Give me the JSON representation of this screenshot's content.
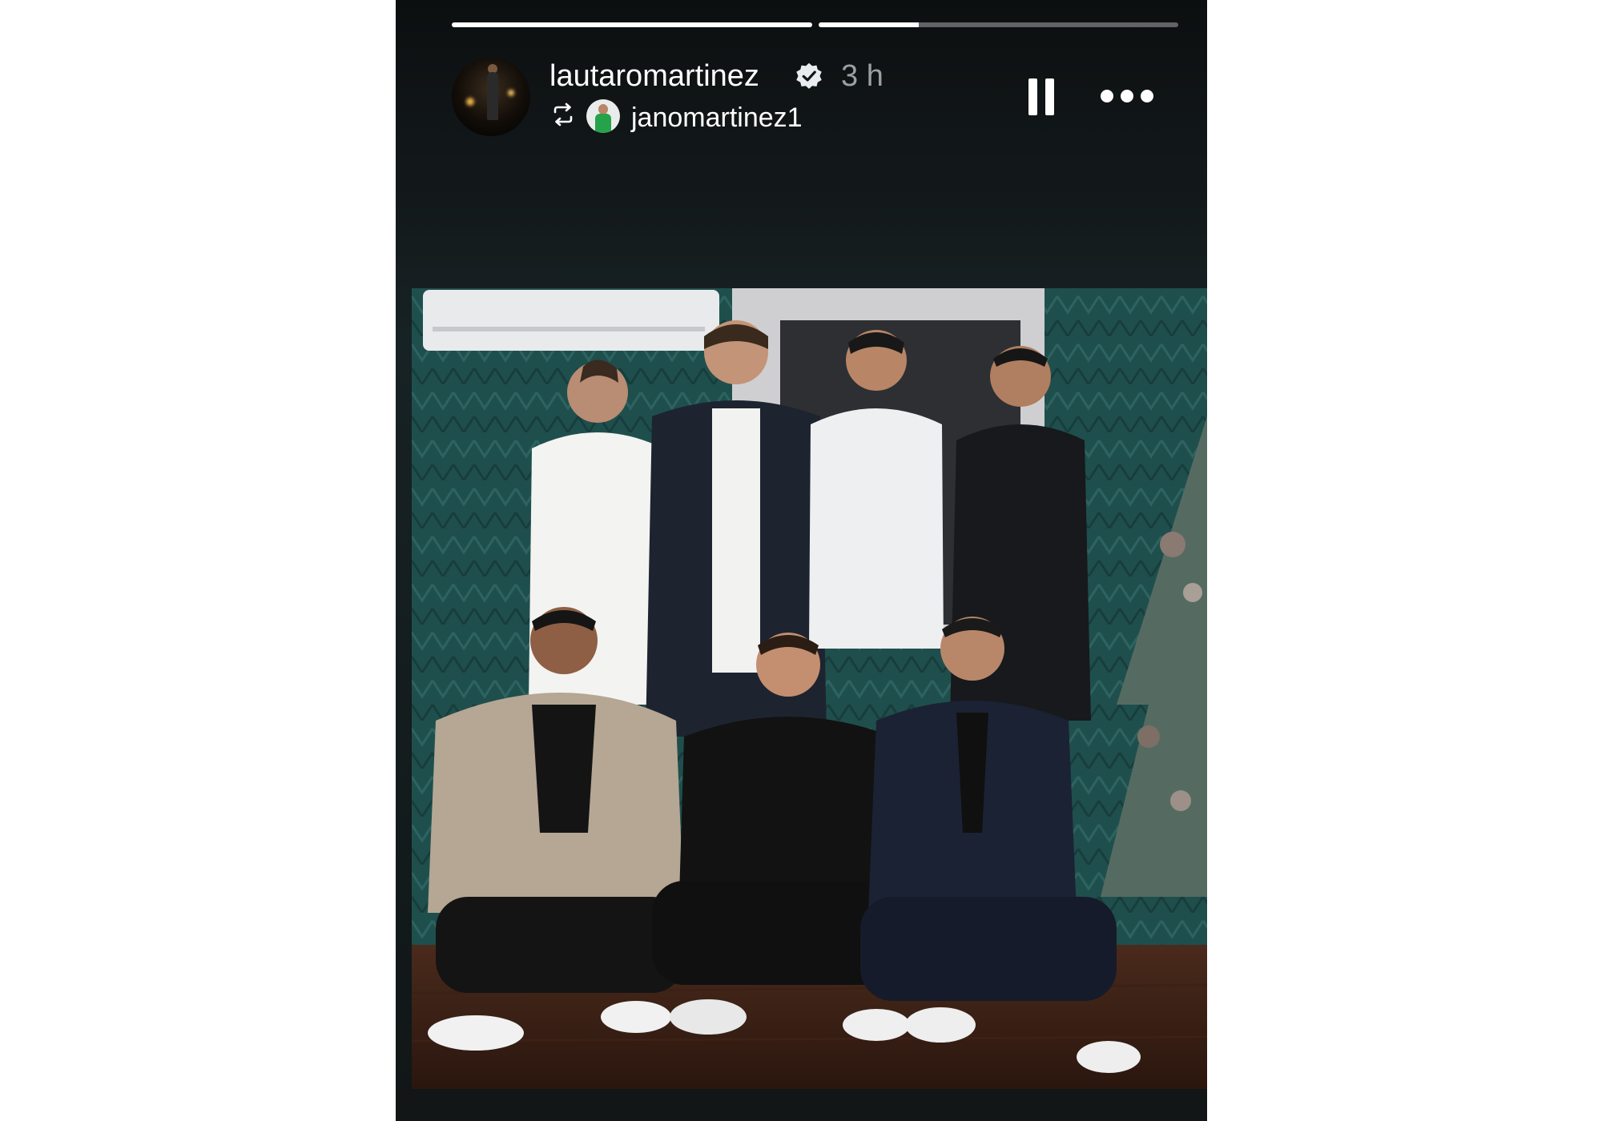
{
  "story": {
    "progress": [
      1.0,
      0.28
    ],
    "author": {
      "username": "lautaromartinez",
      "verified": true,
      "time": "3 h",
      "avatar_icon": "profile-avatar"
    },
    "repost": {
      "icon": "repost-icon",
      "username": "janomartinez1"
    },
    "controls": {
      "pause_icon": "pause-icon",
      "more_icon": "more-options-icon"
    },
    "media": {
      "type": "group-photo",
      "people_count": 7
    }
  },
  "colors": {
    "background": "#ffffff",
    "story_bg": "#13191b",
    "text": "#ffffff",
    "muted_text": "#9aa0a3",
    "wall_teal": "#1d4c4b"
  }
}
